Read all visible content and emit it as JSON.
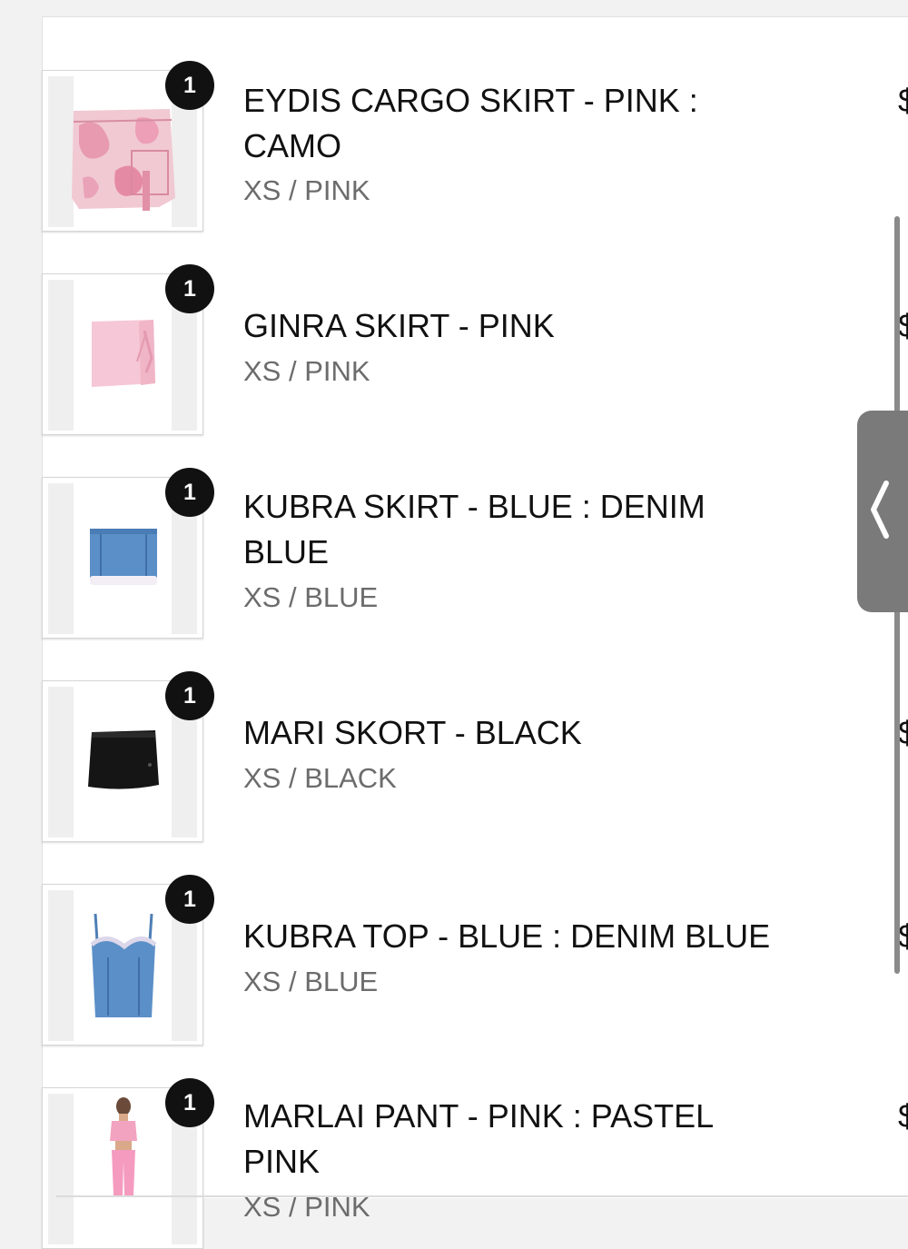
{
  "cart": {
    "items": [
      {
        "name": "EYDIS CARGO SKIRT - PINK :\nCAMO",
        "variant": "XS / PINK",
        "quantity": "1",
        "price": "$",
        "image": "pink-camo-cargo-skirt"
      },
      {
        "name": "GINRA SKIRT - PINK",
        "variant": "XS / PINK",
        "quantity": "1",
        "price": "$",
        "image": "pink-wrap-mini-skirt"
      },
      {
        "name": "KUBRA SKIRT - BLUE : DENIM\nBLUE",
        "variant": "XS / BLUE",
        "quantity": "1",
        "price": "$",
        "image": "denim-mini-skirt"
      },
      {
        "name": "MARI SKORT - BLACK",
        "variant": "XS / BLACK",
        "quantity": "1",
        "price": "$",
        "image": "black-skort"
      },
      {
        "name": "KUBRA TOP - BLUE : DENIM BLUE",
        "variant": "XS / BLUE",
        "quantity": "1",
        "price": "$",
        "image": "denim-corset-top"
      },
      {
        "name": "MARLAI PANT - PINK : PASTEL\nPINK",
        "variant": "XS / PINK",
        "quantity": "1",
        "price": "$",
        "image": "pink-pant-model"
      }
    ]
  },
  "side_tab": {
    "icon": "chevron-left-icon"
  }
}
